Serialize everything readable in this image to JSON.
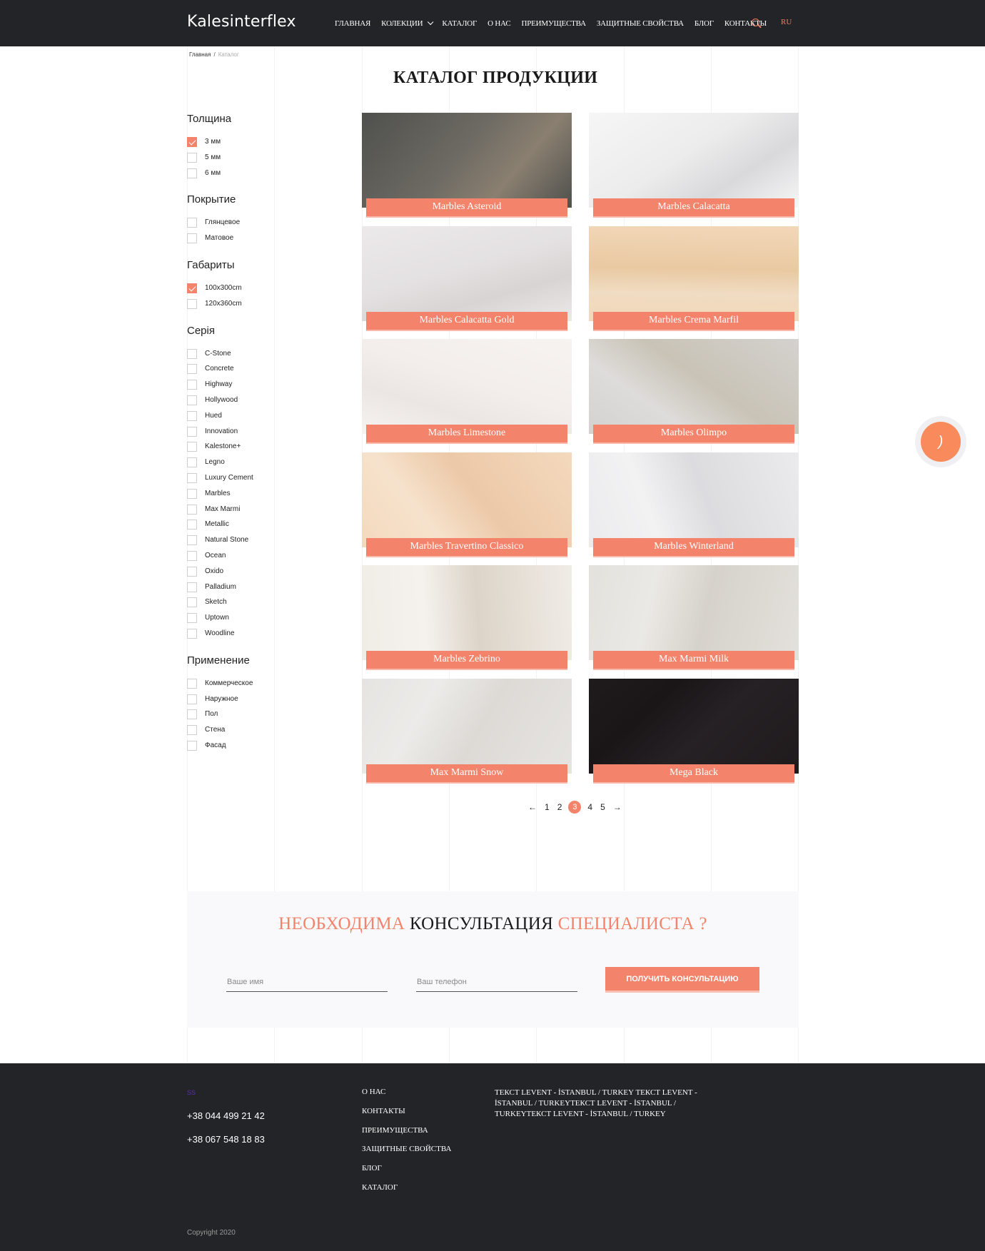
{
  "header": {
    "logo": "Kalesinterflex",
    "nav": [
      "ГЛАВНАЯ",
      "КОЛЕКЦИИ",
      "КАТАЛОГ",
      "О НАС",
      "ПРЕИМУЩЕСТВА",
      "ЗАЩИТНЫЕ СВОЙСТВА",
      "БЛОГ",
      "КОНТАКТЫ"
    ],
    "search_icon": "search-icon",
    "lang": "RU"
  },
  "breadcrumb": {
    "home": "Главная",
    "separator": "/",
    "current": "Каталог"
  },
  "page_title": "КАТАЛОГ ПРОДУКЦИИ",
  "filters": {
    "thickness": {
      "title": "Толщина",
      "options": [
        {
          "label": "3 мм",
          "checked": true
        },
        {
          "label": "5 мм",
          "checked": false
        },
        {
          "label": "6 мм",
          "checked": false
        }
      ]
    },
    "finish": {
      "title": "Покрытие",
      "options": [
        {
          "label": "Глянцевое",
          "checked": false
        },
        {
          "label": "Матовое",
          "checked": false
        }
      ]
    },
    "size": {
      "title": "Габариты",
      "options": [
        {
          "label": "100x300cm",
          "checked": true
        },
        {
          "label": "120x360cm",
          "checked": false
        }
      ]
    },
    "series": {
      "title": "Серія",
      "options": [
        {
          "label": "C-Stone",
          "checked": false
        },
        {
          "label": "Concrete",
          "checked": false
        },
        {
          "label": "Highway",
          "checked": false
        },
        {
          "label": "Hollywood",
          "checked": false
        },
        {
          "label": "Hued",
          "checked": false
        },
        {
          "label": "Innovation",
          "checked": false
        },
        {
          "label": "Kalestone+",
          "checked": false
        },
        {
          "label": "Legno",
          "checked": false
        },
        {
          "label": "Luxury Cement",
          "checked": false
        },
        {
          "label": "Marbles",
          "checked": false
        },
        {
          "label": "Max Marmi",
          "checked": false
        },
        {
          "label": "Metallic",
          "checked": false
        },
        {
          "label": "Natural Stone",
          "checked": false
        },
        {
          "label": "Ocean",
          "checked": false
        },
        {
          "label": "Oxido",
          "checked": false
        },
        {
          "label": "Palladium",
          "checked": false
        },
        {
          "label": "Sketch",
          "checked": false
        },
        {
          "label": "Uptown",
          "checked": false
        },
        {
          "label": "Woodline",
          "checked": false
        }
      ]
    },
    "usage": {
      "title": "Применение",
      "options": [
        {
          "label": "Коммерческое",
          "checked": false
        },
        {
          "label": "Наружное",
          "checked": false
        },
        {
          "label": "Пол",
          "checked": false
        },
        {
          "label": "Стена",
          "checked": false
        },
        {
          "label": "Фасад",
          "checked": false
        }
      ]
    }
  },
  "products": [
    {
      "name": "Marbles Asteroid",
      "colors": [
        "#4f504d",
        "#6d6a63",
        "#8a7f70"
      ]
    },
    {
      "name": "Marbles Calacatta",
      "colors": [
        "#f6f6f6",
        "#ececec",
        "#d9d9dc"
      ]
    },
    {
      "name": "Marbles Calacatta Gold",
      "colors": [
        "#ece9ea",
        "#e4e1e2",
        "#d8d4d4"
      ]
    },
    {
      "name": "Marbles Crema Marfil",
      "colors": [
        "#f2d7b8",
        "#e9c9a2",
        "#f0dcc2"
      ]
    },
    {
      "name": "Marbles Limestone",
      "colors": [
        "#f7f3f1",
        "#f3eeec",
        "#ebe6e4"
      ]
    },
    {
      "name": "Marbles Olimpo",
      "colors": [
        "#d4d2cf",
        "#c9c3b6",
        "#dedcda"
      ]
    },
    {
      "name": "Marbles Travertino Classico",
      "colors": [
        "#f4d9bd",
        "#ecc9a8",
        "#f6e2cc"
      ]
    },
    {
      "name": "Marbles Winterland",
      "colors": [
        "#ebebed",
        "#dcdcdf",
        "#f2f2f3"
      ]
    },
    {
      "name": "Marbles Zebrino",
      "colors": [
        "#f0ece6",
        "#dcd4c8",
        "#f5f2ee"
      ]
    },
    {
      "name": "Max Marmi Milk",
      "colors": [
        "#e3e1dc",
        "#d6d2cb",
        "#ebe9e5"
      ]
    },
    {
      "name": "Max Marmi Snow",
      "colors": [
        "#e6e4e1",
        "#dddad6",
        "#ecebe8"
      ]
    },
    {
      "name": "Mega Black",
      "colors": [
        "#1f1a1c",
        "#262124",
        "#1a1618"
      ]
    }
  ],
  "pagination": {
    "prev": "←",
    "pages": [
      "1",
      "2",
      "3",
      "4",
      "5"
    ],
    "current": "3",
    "next": "→"
  },
  "consultation": {
    "title_part1": "НЕОБХОДИМА",
    "title_part2": "КОНСУЛЬТАЦИЯ",
    "title_part3": "СПЕЦИАЛИСТА ?",
    "name_placeholder": "Ваше имя",
    "phone_placeholder": "Ваш телефон",
    "button": "ПОЛУЧИТЬ КОНСУЛЬТАЦИЮ"
  },
  "fab_icon": "phone-call-icon",
  "footer": {
    "mark": "SS",
    "phones": [
      "+38 044 499 21 42",
      "+38 067 548 18 83"
    ],
    "links": [
      "О НАС",
      "КОНТАКТЫ",
      "ПРЕИМУЩЕСТВА",
      "ЗАЩИТНЫЕ СВОЙСТВА",
      "БЛОГ",
      "КАТАЛОГ"
    ],
    "address": "ТЕКСТ LEVENT - İSTANBUL / TURKEY ТЕКСТ LEVENT - İSTANBUL / TURKEYТЕКСТ LEVENT - İSTANBUL / TURKEYТЕКСТ LEVENT - İSTANBUL / TURKEY",
    "copyright": "Copyright 2020"
  },
  "colors": {
    "accent": "#f3846b",
    "header_bg": "#232427",
    "footer_bg": "#232427"
  }
}
